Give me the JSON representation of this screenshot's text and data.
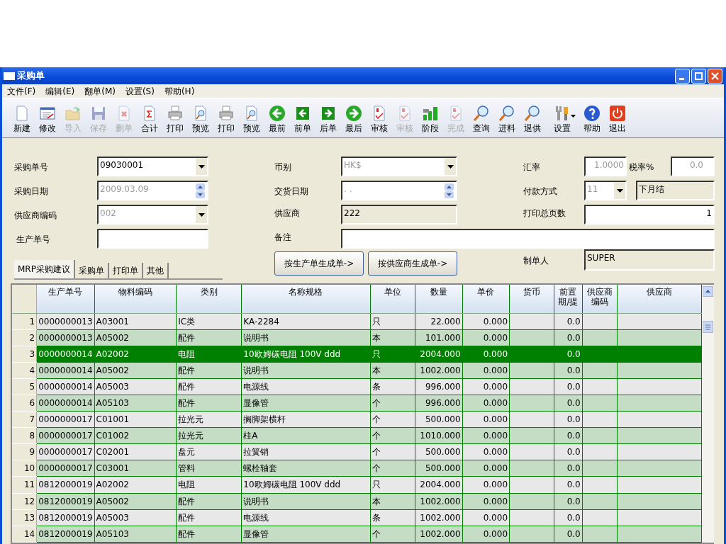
{
  "window": {
    "title": "采购单"
  },
  "menu": [
    "文件(F)",
    "编辑(E)",
    "翻单(M)",
    "设置(S)",
    "帮助(H)"
  ],
  "toolbar": [
    {
      "label": "新建",
      "disabled": false
    },
    {
      "label": "修改",
      "disabled": false
    },
    {
      "label": "导入",
      "disabled": true
    },
    {
      "label": "保存",
      "disabled": true
    },
    {
      "label": "删单",
      "disabled": true
    },
    {
      "label": "合计",
      "disabled": false
    },
    {
      "label": "打印",
      "disabled": false
    },
    {
      "label": "预览",
      "disabled": false
    },
    {
      "label": "打印",
      "disabled": false
    },
    {
      "label": "预览",
      "disabled": false
    },
    {
      "label": "最前",
      "disabled": false
    },
    {
      "label": "前单",
      "disabled": false
    },
    {
      "label": "后单",
      "disabled": false
    },
    {
      "label": "最后",
      "disabled": false
    },
    {
      "label": "审核",
      "disabled": false
    },
    {
      "label": "审核",
      "disabled": true
    },
    {
      "label": "阶段",
      "disabled": false
    },
    {
      "label": "完成",
      "disabled": true
    },
    {
      "label": "查询",
      "disabled": false
    },
    {
      "label": "进料",
      "disabled": false
    },
    {
      "label": "退供",
      "disabled": false
    },
    {
      "label": "设置",
      "disabled": false
    },
    {
      "label": "帮助",
      "disabled": false
    },
    {
      "label": "退出",
      "disabled": false
    }
  ],
  "form": {
    "order_no": {
      "label": "采购单号",
      "kind": "combo",
      "value": "09030001",
      "disabled": false
    },
    "currency": {
      "label": "币别",
      "kind": "combo",
      "value": "HK$",
      "disabled": true
    },
    "exchange_rate": {
      "label": "汇率",
      "kind": "number",
      "value": "1.0000",
      "disabled": true
    },
    "tax_rate": {
      "label": "税率%",
      "kind": "number",
      "value": "0.0",
      "disabled": true
    },
    "order_date": {
      "label": "采购日期",
      "kind": "spin",
      "value": "2009.03.09",
      "disabled": true
    },
    "delivery_date": {
      "label": "交货日期",
      "kind": "spin",
      "value": ". .",
      "disabled": true
    },
    "payment": {
      "label": "付款方式",
      "kind": "combo",
      "value": "11",
      "disabled": true
    },
    "payment_name": {
      "kind": "readonly",
      "value": "下月结",
      "disabled": false
    },
    "supplier_code": {
      "label": "供应商编码",
      "kind": "combo",
      "value": "002",
      "disabled": true
    },
    "supplier": {
      "label": "供应商",
      "kind": "readonly",
      "value": "222",
      "disabled": false
    },
    "print_pages": {
      "label": "打印总页数",
      "kind": "number",
      "value": "1",
      "disabled": false
    },
    "production_no": {
      "label": "生产单号",
      "kind": "text"
    },
    "remark": {
      "label": "备注",
      "kind": "text"
    },
    "creator": {
      "label": "制单人",
      "kind": "readonly",
      "value": "SUPER",
      "disabled": false
    }
  },
  "tabs": [
    {
      "label": "MRP采购建议",
      "selected": true
    },
    {
      "label": "采购单",
      "selected": false
    },
    {
      "label": "打印单",
      "selected": false
    },
    {
      "label": "其他",
      "selected": false
    }
  ],
  "buttons": [
    "按生产单生成单->",
    "按供应商生成单->"
  ],
  "table": {
    "columns": [
      "生产单号",
      "物料编码",
      "类别",
      "名称规格",
      "单位",
      "数量",
      "单价",
      "货币",
      "前置期/提",
      "供应商编码",
      "供应商"
    ],
    "rows": [
      {
        "num": "1",
        "selected": false,
        "cells": [
          "0000000013",
          "A03001",
          "IC类",
          "KA-2284",
          "只",
          "22.000",
          "0.000",
          "",
          "0.0",
          "",
          ""
        ]
      },
      {
        "num": "2",
        "selected": false,
        "cells": [
          "0000000013",
          "A05002",
          "配件",
          "说明书",
          "本",
          "101.000",
          "0.000",
          "",
          "0.0",
          "",
          ""
        ]
      },
      {
        "num": "3",
        "selected": true,
        "cells": [
          "0000000014",
          "A02002",
          "电阻",
          "10欧姆碳电阻 100V    ddd",
          "只",
          "2004.000",
          "0.000",
          "",
          "0.0",
          "",
          ""
        ]
      },
      {
        "num": "4",
        "selected": false,
        "cells": [
          "0000000014",
          "A05002",
          "配件",
          "说明书",
          "本",
          "1002.000",
          "0.000",
          "",
          "0.0",
          "",
          ""
        ]
      },
      {
        "num": "5",
        "selected": false,
        "cells": [
          "0000000014",
          "A05003",
          "配件",
          "电源线",
          "条",
          "996.000",
          "0.000",
          "",
          "0.0",
          "",
          ""
        ]
      },
      {
        "num": "6",
        "selected": false,
        "cells": [
          "0000000014",
          "A05103",
          "配件",
          "显像管",
          "个",
          "996.000",
          "0.000",
          "",
          "0.0",
          "",
          ""
        ]
      },
      {
        "num": "7",
        "selected": false,
        "cells": [
          "0000000017",
          "C01001",
          "拉光元",
          "搁脚架横杆",
          "个",
          "500.000",
          "0.000",
          "",
          "0.0",
          "",
          ""
        ]
      },
      {
        "num": "8",
        "selected": false,
        "cells": [
          "0000000017",
          "C01002",
          "拉光元",
          "柱A",
          "个",
          "1010.000",
          "0.000",
          "",
          "0.0",
          "",
          ""
        ]
      },
      {
        "num": "9",
        "selected": false,
        "cells": [
          "0000000017",
          "C02001",
          "盘元",
          "拉簧销",
          "个",
          "500.000",
          "0.000",
          "",
          "0.0",
          "",
          ""
        ]
      },
      {
        "num": "10",
        "selected": false,
        "cells": [
          "0000000017",
          "C03001",
          "管料",
          "螺栓轴套",
          "个",
          "500.000",
          "0.000",
          "",
          "0.0",
          "",
          ""
        ]
      },
      {
        "num": "11",
        "selected": false,
        "cells": [
          "0812000019",
          "A02002",
          "电阻",
          "10欧姆碳电阻 100V    ddd",
          "只",
          "2004.000",
          "0.000",
          "",
          "0.0",
          "",
          ""
        ]
      },
      {
        "num": "12",
        "selected": false,
        "cells": [
          "0812000019",
          "A05002",
          "配件",
          "说明书",
          "本",
          "1002.000",
          "0.000",
          "",
          "0.0",
          "",
          ""
        ]
      },
      {
        "num": "13",
        "selected": false,
        "cells": [
          "0812000019",
          "A05003",
          "配件",
          "电源线",
          "条",
          "1002.000",
          "0.000",
          "",
          "0.0",
          "",
          ""
        ]
      },
      {
        "num": "14",
        "selected": false,
        "cells": [
          "0812000019",
          "A05103",
          "配件",
          "显像管",
          "个",
          "1002.000",
          "0.000",
          "",
          "0.0",
          "",
          ""
        ]
      }
    ]
  }
}
